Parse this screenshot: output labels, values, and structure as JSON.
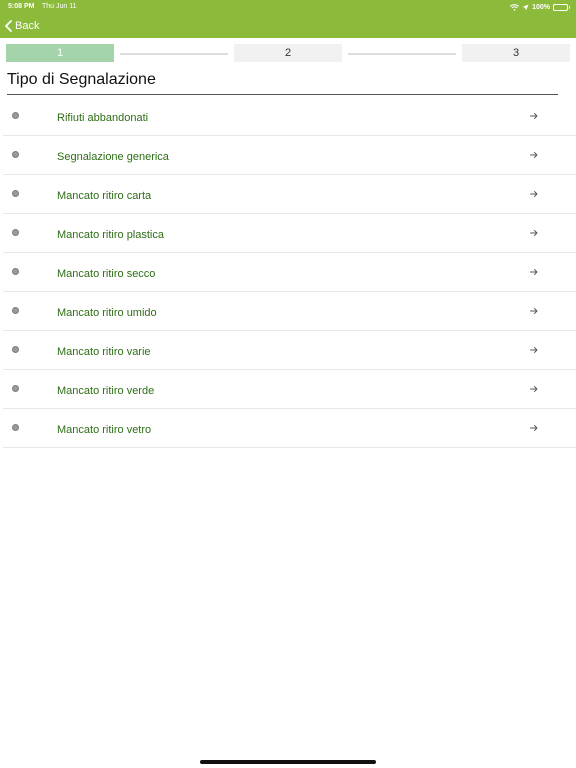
{
  "status_bar": {
    "time": "5:08 PM",
    "date": "Thu Jun 11",
    "battery": "100%"
  },
  "nav": {
    "back_label": "Back"
  },
  "stepper": {
    "steps": [
      {
        "label": "1",
        "active": true
      },
      {
        "label": "2",
        "active": false
      },
      {
        "label": "3",
        "active": false
      }
    ]
  },
  "section": {
    "title": "Tipo di Segnalazione"
  },
  "items": [
    {
      "label": "Rifiuti abbandonati"
    },
    {
      "label": "Segnalazione generica"
    },
    {
      "label": "Mancato ritiro carta"
    },
    {
      "label": "Mancato ritiro plastica"
    },
    {
      "label": "Mancato ritiro secco"
    },
    {
      "label": "Mancato ritiro umido"
    },
    {
      "label": "Mancato ritiro varie"
    },
    {
      "label": "Mancato ritiro verde"
    },
    {
      "label": "Mancato ritiro vetro"
    }
  ],
  "colors": {
    "header": "#8cba3a",
    "active_step": "#a5d3aa",
    "inactive_step": "#f1f1f1",
    "item_text": "#2e6e16"
  },
  "icons": {
    "back": "chevron-left-icon",
    "wifi": "wifi-icon",
    "location": "location-arrow-icon",
    "battery": "battery-icon",
    "radio": "radio-dot-icon",
    "row_arrow": "arrow-right-icon"
  }
}
